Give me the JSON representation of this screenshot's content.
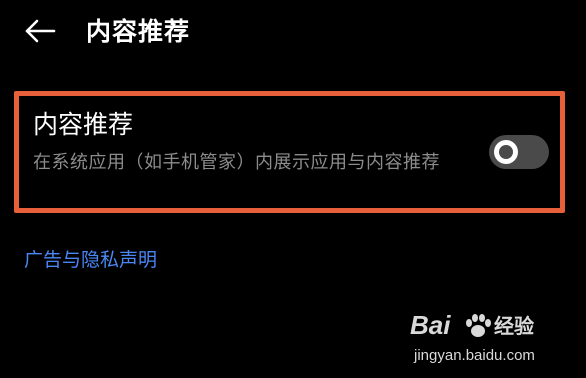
{
  "header": {
    "back_icon": "arrow-left-icon",
    "title": "内容推荐"
  },
  "setting": {
    "title": "内容推荐",
    "description": "在系统应用（如手机管家）内展示应用与内容推荐",
    "toggle_state": "off",
    "highlight_color": "#e8603a"
  },
  "privacy_link": {
    "label": "广告与隐私声明",
    "color": "#4a87f5"
  },
  "watermark": {
    "brand_prefix": "Bai",
    "brand_suffix": "经验",
    "url": "jingyan.baidu.com",
    "icon": "paw-icon"
  }
}
